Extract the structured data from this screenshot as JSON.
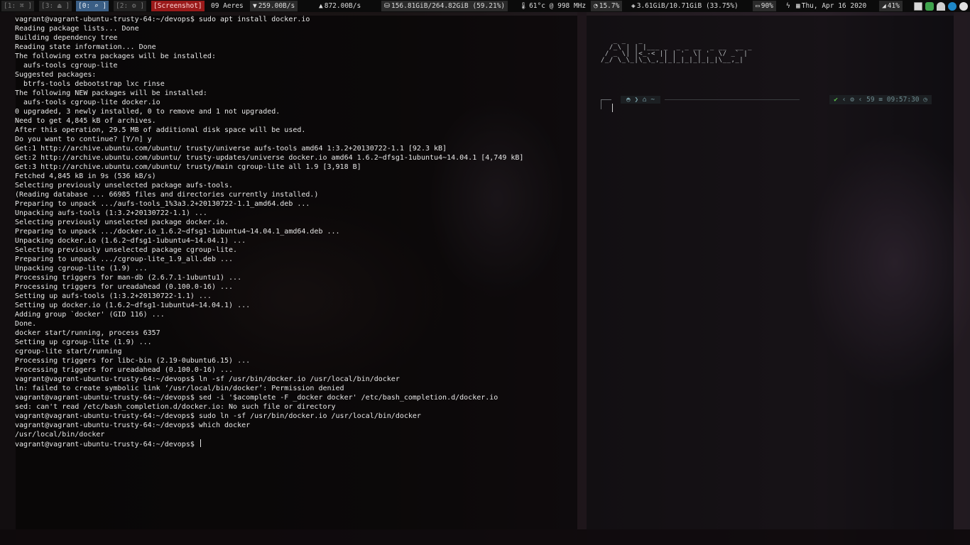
{
  "bar": {
    "workspaces": [
      {
        "label": "[1: ⌘ ]",
        "state": "inactive"
      },
      {
        "label": "[3: ⏏ ]",
        "state": "inactive"
      },
      {
        "label": "[0: ⌕ ]",
        "state": "active"
      },
      {
        "label": "[2: ⚙ ]",
        "state": "inactive"
      },
      {
        "label": "[Screenshot]",
        "state": "urgent"
      }
    ],
    "location": "09 Aeres",
    "net_down": "259.00B/s",
    "net_up": "872.00B/s",
    "disk": "156.81GiB/264.82GiB (59.21%)",
    "cpu_temp": "61°c @ 998 MHz",
    "cpu_load": "15.7%",
    "memory": "3.61GiB/10.71GiB (33.75%)",
    "battery": "90%",
    "date": "Thu, Apr 16 2020",
    "volume": "41%",
    "icons": {
      "down": "▼",
      "up": "▲",
      "disk": "⛁",
      "temp": "🌡",
      "cpu": "◔",
      "mem": "◈",
      "battery": "▭",
      "power": "ϟ",
      "calendar": "▦",
      "volume": "◢"
    },
    "colors": {
      "active": "#3a5e85",
      "urgent": "#9a1a1a",
      "background": "#0b0b0b"
    }
  },
  "terminal": {
    "lines": [
      "vagrant@vagrant-ubuntu-trusty-64:~/devops$ sudo apt install docker.io",
      "Reading package lists... Done",
      "Building dependency tree",
      "Reading state information... Done",
      "The following extra packages will be installed:",
      "  aufs-tools cgroup-lite",
      "Suggested packages:",
      "  btrfs-tools debootstrap lxc rinse",
      "The following NEW packages will be installed:",
      "  aufs-tools cgroup-lite docker.io",
      "0 upgraded, 3 newly installed, 0 to remove and 1 not upgraded.",
      "Need to get 4,845 kB of archives.",
      "After this operation, 29.5 MB of additional disk space will be used.",
      "Do you want to continue? [Y/n] y",
      "Get:1 http://archive.ubuntu.com/ubuntu/ trusty/universe aufs-tools amd64 1:3.2+20130722-1.1 [92.3 kB]",
      "Get:2 http://archive.ubuntu.com/ubuntu/ trusty-updates/universe docker.io amd64 1.6.2~dfsg1-1ubuntu4~14.04.1 [4,749 kB]",
      "Get:3 http://archive.ubuntu.com/ubuntu/ trusty/main cgroup-lite all 1.9 [3,918 B]",
      "Fetched 4,845 kB in 9s (536 kB/s)",
      "Selecting previously unselected package aufs-tools.",
      "(Reading database ... 66985 files and directories currently installed.)",
      "Preparing to unpack .../aufs-tools_1%3a3.2+20130722-1.1_amd64.deb ...",
      "Unpacking aufs-tools (1:3.2+20130722-1.1) ...",
      "Selecting previously unselected package docker.io.",
      "Preparing to unpack .../docker.io_1.6.2~dfsg1-1ubuntu4~14.04.1_amd64.deb ...",
      "Unpacking docker.io (1.6.2~dfsg1-1ubuntu4~14.04.1) ...",
      "Selecting previously unselected package cgroup-lite.",
      "Preparing to unpack .../cgroup-lite_1.9_all.deb ...",
      "Unpacking cgroup-lite (1.9) ...",
      "Processing triggers for man-db (2.6.7.1-1ubuntu1) ...",
      "Processing triggers for ureadahead (0.100.0-16) ...",
      "Setting up aufs-tools (1:3.2+20130722-1.1) ...",
      "Setting up docker.io (1.6.2~dfsg1-1ubuntu4~14.04.1) ...",
      "Adding group `docker' (GID 116) ...",
      "Done.",
      "docker start/running, process 6357",
      "Setting up cgroup-lite (1.9) ...",
      "cgroup-lite start/running",
      "Processing triggers for libc-bin (2.19-0ubuntu6.15) ...",
      "Processing triggers for ureadahead (0.100.0-16) ...",
      "vagrant@vagrant-ubuntu-trusty-64:~/devops$ ln -sf /usr/bin/docker.io /usr/local/bin/docker",
      "ln: failed to create symbolic link ‘/usr/local/bin/docker’: Permission denied",
      "vagrant@vagrant-ubuntu-trusty-64:~/devops$ sed -i '$acomplete -F _docker docker' /etc/bash_completion.d/docker.io",
      "sed: can't read /etc/bash_completion.d/docker.io: No such file or directory",
      "vagrant@vagrant-ubuntu-trusty-64:~/devops$ sudo ln -sf /usr/bin/docker.io /usr/local/bin/docker",
      "vagrant@vagrant-ubuntu-trusty-64:~/devops$ which docker",
      "/usr/local/bin/docker",
      "vagrant@vagrant-ubuntu-trusty-64:~/devops$ "
    ]
  },
  "pane2": {
    "ascii_art": "   _ _   _                                  \n  /_\\ | | |___ _  _ _ __  _ __  __ _       \n / _ \\| |<_-< || | '  \\| '  \\/ _` |      \n/_/ \\_\\_|\\_\\_,_|_|_|_|_|_|_|\\__,_|      ",
    "prompt_left": "◓ ❯ ⌂ ~",
    "prompt_right_status": "✔",
    "prompt_right_jobs": "⚙",
    "prompt_right_count": "59",
    "prompt_right_sep": "≡",
    "prompt_right_time": "09:57:30",
    "prompt_right_clock": "◷"
  }
}
